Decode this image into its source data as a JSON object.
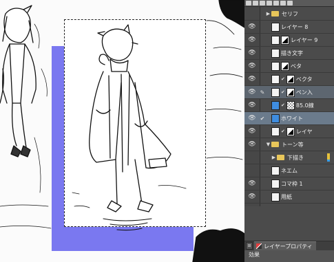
{
  "canvas": {
    "page_frame_color": "#ffffff",
    "blue_fill_color": "#7a78f0"
  },
  "layer_panel": {
    "toolbar_icons": [
      "layers-icon",
      "new-raster-layer-icon",
      "new-vector-layer-icon",
      "new-folder-icon",
      "copy-layer-icon",
      "merge-icon",
      "delete-icon"
    ],
    "layers": [
      {
        "name": "セリフ",
        "kind": "folder",
        "visible": false,
        "indent": 1
      },
      {
        "name": "レイヤー 8",
        "kind": "raster",
        "visible": true,
        "indent": 1
      },
      {
        "name": "レイヤー 9",
        "kind": "raster-mask",
        "visible": true,
        "indent": 1
      },
      {
        "name": "描き文字",
        "kind": "raster",
        "visible": true,
        "indent": 1
      },
      {
        "name": "ベタ",
        "kind": "raster-mask",
        "visible": true,
        "indent": 1
      },
      {
        "name": "ベクタ",
        "kind": "vector-linked",
        "visible": true,
        "indent": 1
      },
      {
        "name": "ペン入",
        "kind": "vector-linked",
        "visible": true,
        "indent": 1,
        "state": "selected-secondary"
      },
      {
        "name": "85.0線",
        "kind": "tone-linked",
        "visible": true,
        "indent": 1
      },
      {
        "name": "ホワイト",
        "kind": "color",
        "visible": true,
        "indent": 1,
        "state": "selected"
      },
      {
        "name": "レイヤ",
        "kind": "vector-linked",
        "visible": true,
        "indent": 1
      },
      {
        "name": "トーン等",
        "kind": "folder-open",
        "visible": true,
        "indent": 1
      },
      {
        "name": "下描き",
        "kind": "folder",
        "visible": false,
        "indent": 1,
        "marker": true
      },
      {
        "name": "ネエム",
        "kind": "raster",
        "visible": false,
        "indent": 1
      },
      {
        "name": "コマ枠 1",
        "kind": "raster",
        "visible": true,
        "indent": 1
      },
      {
        "name": "用紙",
        "kind": "paper",
        "visible": true,
        "indent": 1
      }
    ],
    "bottom_tab_label": "レイヤープロパティ",
    "property_label": "効果"
  }
}
